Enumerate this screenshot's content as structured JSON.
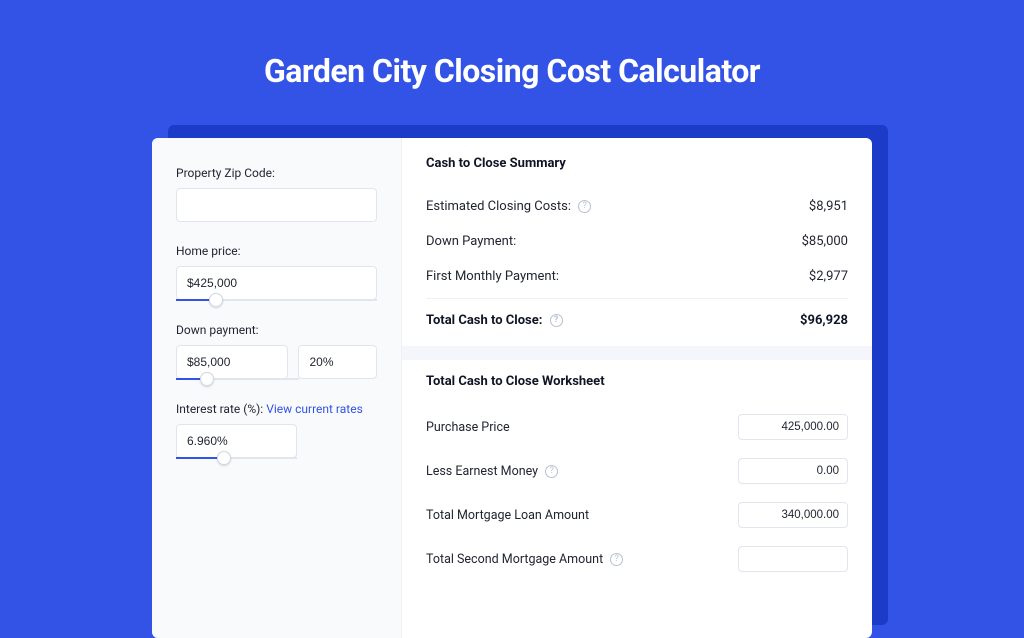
{
  "page": {
    "title": "Garden City Closing Cost Calculator"
  },
  "form": {
    "zip": {
      "label": "Property Zip Code:",
      "value": ""
    },
    "home_price": {
      "label": "Home price:",
      "value": "$425,000",
      "slider_pct": 20
    },
    "down_payment": {
      "label": "Down payment:",
      "value": "$85,000",
      "pct_value": "20%",
      "slider_pct": 25
    },
    "interest_rate": {
      "label": "Interest rate (%):",
      "link_text": "View current rates",
      "value": "6.960%",
      "slider_pct": 40
    }
  },
  "summary": {
    "title": "Cash to Close Summary",
    "rows": [
      {
        "label": "Estimated Closing Costs:",
        "help": true,
        "value": "$8,951"
      },
      {
        "label": "Down Payment:",
        "help": false,
        "value": "$85,000"
      },
      {
        "label": "First Monthly Payment:",
        "help": false,
        "value": "$2,977"
      }
    ],
    "total": {
      "label": "Total Cash to Close:",
      "help": true,
      "value": "$96,928"
    }
  },
  "worksheet": {
    "title": "Total Cash to Close Worksheet",
    "rows": [
      {
        "label": "Purchase Price",
        "help": false,
        "value": "425,000.00"
      },
      {
        "label": "Less Earnest Money",
        "help": true,
        "value": "0.00"
      },
      {
        "label": "Total Mortgage Loan Amount",
        "help": false,
        "value": "340,000.00"
      },
      {
        "label": "Total Second Mortgage Amount",
        "help": true,
        "value": ""
      }
    ]
  }
}
